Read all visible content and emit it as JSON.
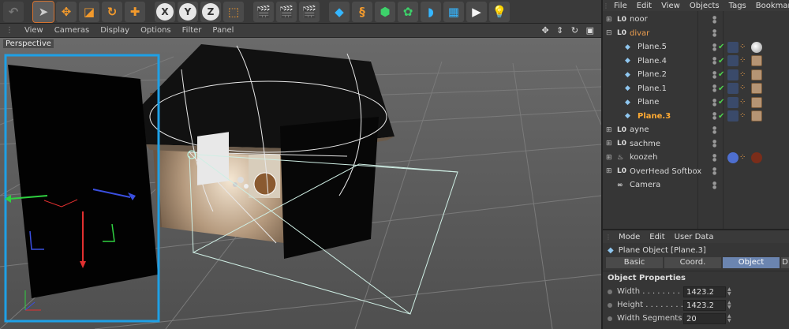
{
  "viewport": {
    "menu": [
      "View",
      "Cameras",
      "Display",
      "Options",
      "Filter",
      "Panel"
    ],
    "nav_icons": "✥ ⇕ ↻ ▣",
    "view_name": "Perspective"
  },
  "object_manager": {
    "menu": [
      "File",
      "Edit",
      "View",
      "Objects",
      "Tags",
      "Bookmar"
    ],
    "objects": [
      {
        "name": "noor",
        "type": "null",
        "indent": 0,
        "expand": "+",
        "style": "normal"
      },
      {
        "name": "divar",
        "type": "null",
        "indent": 0,
        "expand": "−",
        "style": "orange"
      },
      {
        "name": "Plane.5",
        "type": "plane",
        "indent": 1,
        "expand": "",
        "style": "normal"
      },
      {
        "name": "Plane.4",
        "type": "plane",
        "indent": 1,
        "expand": "",
        "style": "normal"
      },
      {
        "name": "Plane.2",
        "type": "plane",
        "indent": 1,
        "expand": "",
        "style": "normal"
      },
      {
        "name": "Plane.1",
        "type": "plane",
        "indent": 1,
        "expand": "",
        "style": "normal"
      },
      {
        "name": "Plane",
        "type": "plane",
        "indent": 1,
        "expand": "",
        "style": "normal"
      },
      {
        "name": "Plane.3",
        "type": "plane",
        "indent": 1,
        "expand": "",
        "style": "selected"
      },
      {
        "name": "ayne",
        "type": "null",
        "indent": 0,
        "expand": "+",
        "style": "normal"
      },
      {
        "name": "sachme",
        "type": "null",
        "indent": 0,
        "expand": "+",
        "style": "normal"
      },
      {
        "name": "koozeh",
        "type": "lathe",
        "indent": 0,
        "expand": "+",
        "style": "normal"
      },
      {
        "name": "OverHead Softbox",
        "type": "null",
        "indent": 0,
        "expand": "+",
        "style": "normal"
      },
      {
        "name": "Camera",
        "type": "camera",
        "indent": 0,
        "expand": "",
        "style": "normal"
      }
    ]
  },
  "attribute_manager": {
    "menu": [
      "Mode",
      "Edit",
      "User Data"
    ],
    "title": "Plane Object [Plane.3]",
    "tabs": [
      "Basic",
      "Coord.",
      "Object",
      "D"
    ],
    "active_tab": "Object",
    "section": "Object Properties",
    "properties": [
      {
        "label": "Width . . . . . . . . .",
        "value": "1423.2 cm"
      },
      {
        "label": "Height . . . . . . . . .",
        "value": "1423.2 cm"
      },
      {
        "label": "Width Segments",
        "value": "20"
      }
    ]
  },
  "colors": {
    "accent": "#d6732f",
    "selected_text": "#ffaa33",
    "active_tab": "#6b85b0",
    "viewport_bg": "#5a5a5a",
    "selection_frame": "#1ea0e6"
  }
}
